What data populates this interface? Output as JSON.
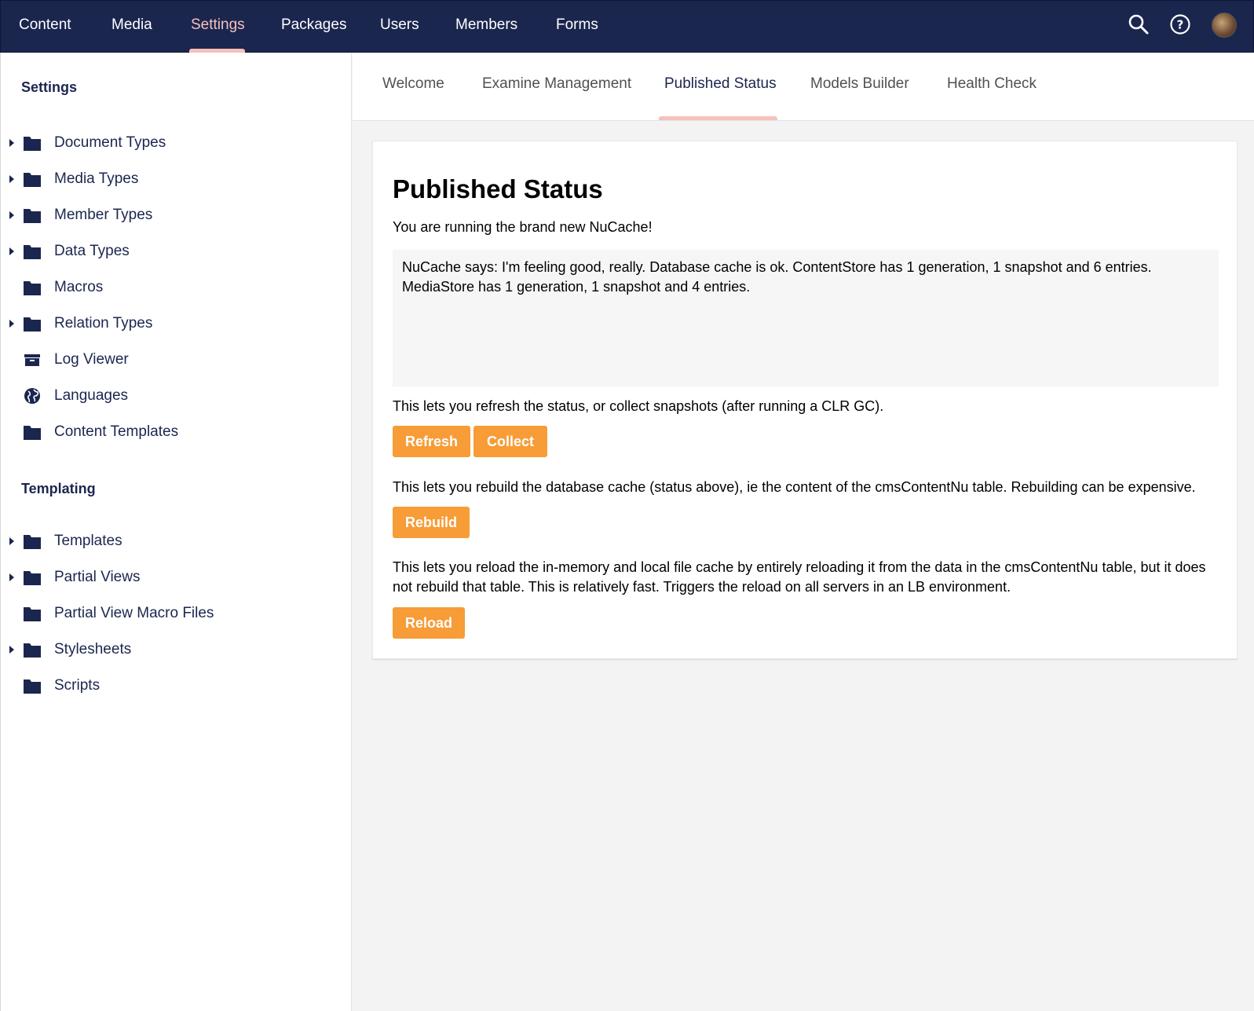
{
  "topnav": {
    "items": [
      "Content",
      "Media",
      "Settings",
      "Packages",
      "Users",
      "Members",
      "Forms"
    ],
    "active": "Settings",
    "icons": [
      "search-icon",
      "help-icon",
      "avatar"
    ]
  },
  "sidebar": {
    "settings_title": "Settings",
    "settings_items": [
      {
        "label": "Document Types",
        "icon": "folder-icon",
        "expandable": true
      },
      {
        "label": "Media Types",
        "icon": "folder-icon",
        "expandable": true
      },
      {
        "label": "Member Types",
        "icon": "folder-icon",
        "expandable": true
      },
      {
        "label": "Data Types",
        "icon": "folder-icon",
        "expandable": true
      },
      {
        "label": "Macros",
        "icon": "folder-icon",
        "expandable": false
      },
      {
        "label": "Relation Types",
        "icon": "folder-icon",
        "expandable": true
      },
      {
        "label": "Log Viewer",
        "icon": "archive-box-icon",
        "expandable": false
      },
      {
        "label": "Languages",
        "icon": "globe-icon",
        "expandable": false
      },
      {
        "label": "Content Templates",
        "icon": "folder-icon",
        "expandable": false
      }
    ],
    "templating_title": "Templating",
    "templating_items": [
      {
        "label": "Templates",
        "icon": "folder-icon",
        "expandable": true
      },
      {
        "label": "Partial Views",
        "icon": "folder-icon",
        "expandable": true
      },
      {
        "label": "Partial View Macro Files",
        "icon": "folder-icon",
        "expandable": false
      },
      {
        "label": "Stylesheets",
        "icon": "folder-icon",
        "expandable": true
      },
      {
        "label": "Scripts",
        "icon": "folder-icon",
        "expandable": false
      }
    ]
  },
  "tabs": {
    "items": [
      "Welcome",
      "Examine Management",
      "Published Status",
      "Models Builder",
      "Health Check"
    ],
    "active": "Published Status"
  },
  "panel": {
    "title": "Published Status",
    "intro": "You are running the brand new NuCache!",
    "status_text": "NuCache says: I'm feeling good, really. Database cache is ok. ContentStore has 1 generation, 1 snapshot and 6 entries. MediaStore has 1 generation, 1 snapshot and 4 entries.",
    "refresh_text": "This lets you refresh the status, or collect snapshots (after running a CLR GC).",
    "refresh_button": "Refresh",
    "collect_button": "Collect",
    "rebuild_text": "This lets you rebuild the database cache (status above), ie the content of the cmsContentNu table. Rebuilding can be expensive.",
    "rebuild_button": "Rebuild",
    "reload_text": "This lets you reload the in-memory and local file cache by entirely reloading it from the data in the cmsContentNu table, but it does not rebuild that table. This is relatively fast. Triggers the reload on all servers in an LB environment.",
    "reload_button": "Reload"
  },
  "colors": {
    "nav_bg": "#1b264f",
    "accent_pink": "#f5c1bc",
    "button_orange": "#f79c37"
  }
}
